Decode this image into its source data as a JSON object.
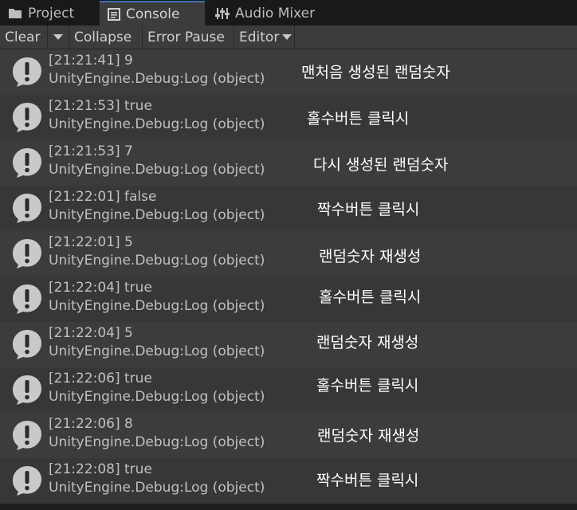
{
  "tabs": [
    {
      "label": "Project",
      "icon": "folder-icon"
    },
    {
      "label": "Console",
      "icon": "console-icon"
    },
    {
      "label": "Audio Mixer",
      "icon": "mixer-icon"
    }
  ],
  "toolbar": {
    "clear_label": "Clear",
    "collapse_label": "Collapse",
    "error_pause_label": "Error Pause",
    "editor_label": "Editor"
  },
  "logs": [
    {
      "line1": "[21:21:41] 9",
      "line2": "UnityEngine.Debug:Log (object)",
      "icon": "info-message-icon"
    },
    {
      "line1": "[21:21:53] true",
      "line2": "UnityEngine.Debug:Log (object)",
      "icon": "info-message-icon"
    },
    {
      "line1": "[21:21:53] 7",
      "line2": "UnityEngine.Debug:Log (object)",
      "icon": "info-message-icon"
    },
    {
      "line1": "[21:22:01] false",
      "line2": "UnityEngine.Debug:Log (object)",
      "icon": "info-message-icon"
    },
    {
      "line1": "[21:22:01] 5",
      "line2": "UnityEngine.Debug:Log (object)",
      "icon": "info-message-icon"
    },
    {
      "line1": "[21:22:04] true",
      "line2": "UnityEngine.Debug:Log (object)",
      "icon": "info-message-icon"
    },
    {
      "line1": "[21:22:04] 5",
      "line2": "UnityEngine.Debug:Log (object)",
      "icon": "info-message-icon"
    },
    {
      "line1": "[21:22:06] true",
      "line2": "UnityEngine.Debug:Log (object)",
      "icon": "info-message-icon"
    },
    {
      "line1": "[21:22:06] 8",
      "line2": "UnityEngine.Debug:Log (object)",
      "icon": "info-message-icon"
    },
    {
      "line1": "[21:22:08] true",
      "line2": "UnityEngine.Debug:Log (object)",
      "icon": "info-message-icon"
    }
  ],
  "annotations": [
    "맨처음 생성된 랜덤숫자",
    "홀수버튼 클릭시",
    "다시 생성된 랜덤숫자",
    "짝수버튼 클릭시",
    "랜덤숫자 재생성",
    "홀수버튼 클릭시",
    "랜덤숫자 재생성",
    "홀수버튼 클릭시",
    "랜덤숫자 재생성",
    "짝수버튼 클릭시"
  ]
}
